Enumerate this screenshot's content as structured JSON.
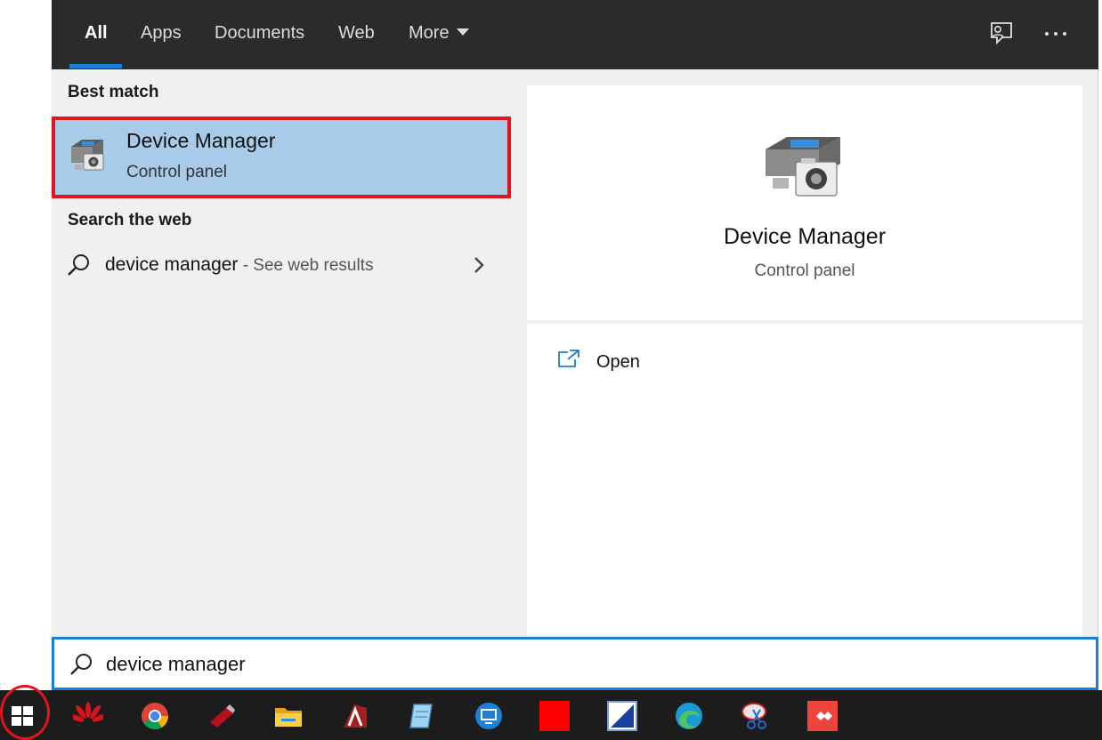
{
  "tabs": [
    {
      "label": "All",
      "active": true
    },
    {
      "label": "Apps"
    },
    {
      "label": "Documents"
    },
    {
      "label": "Web"
    },
    {
      "label": "More"
    }
  ],
  "top_icons": [
    "feedback-icon",
    "more-options-icon"
  ],
  "best_match": {
    "section_label": "Best match",
    "title": "Device Manager",
    "subtitle": "Control panel",
    "icon": "device-manager-icon"
  },
  "web_search": {
    "section_label": "Search the web",
    "query": "device manager",
    "suffix": " - See web results"
  },
  "preview": {
    "title": "Device Manager",
    "subtitle": "Control panel"
  },
  "actions": [
    {
      "label": "Open",
      "icon": "open-icon"
    }
  ],
  "search": {
    "value": "device manager"
  },
  "taskbar": {
    "items": [
      "start-icon",
      "huawei-icon",
      "chrome-icon",
      "usb-drive-icon",
      "autocad-icon",
      "notepad-icon",
      "remote-desktop-icon",
      "red-app-icon",
      "paint-icon",
      "edge-icon",
      "snipping-tool-icon",
      "anydesk-icon"
    ]
  },
  "colors": {
    "accent": "#1a7fd4",
    "highlight": "#a9cbea",
    "annotation_red": "#e2141f"
  }
}
